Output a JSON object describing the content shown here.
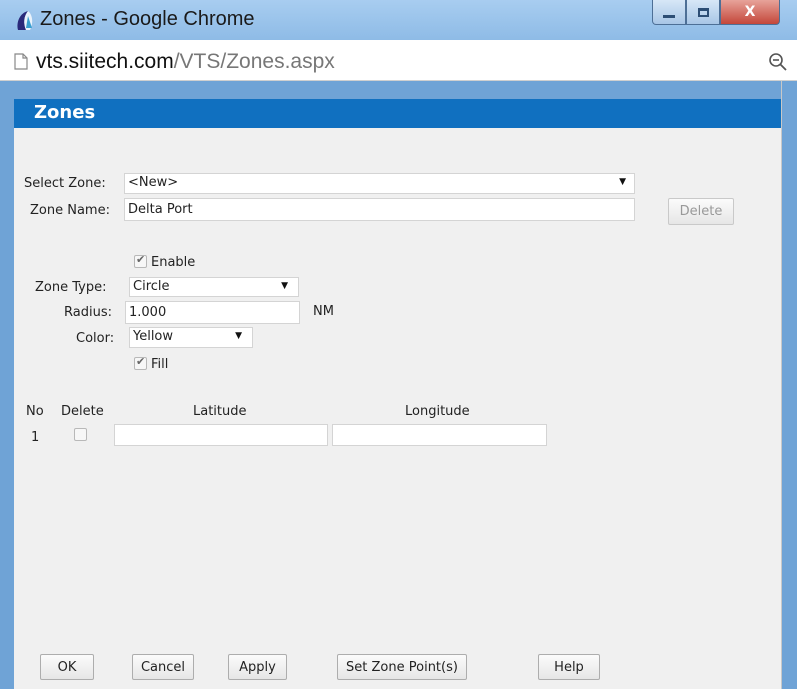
{
  "window": {
    "title": "Zones - Google Chrome",
    "controls": {
      "minimize": "minimize",
      "maximize": "maximize",
      "close": "X"
    }
  },
  "address": {
    "domain": "vts.siitech.com",
    "path": "/VTS/Zones.aspx"
  },
  "header": {
    "title": "Zones"
  },
  "form": {
    "select_zone_label": "Select Zone:",
    "select_zone_value": "<New>",
    "zone_name_label": "Zone Name:",
    "zone_name_value": "Delta Port",
    "delete_button": "Delete",
    "enable_label": "Enable",
    "enable_checked": true,
    "zone_type_label": "Zone Type:",
    "zone_type_value": "Circle",
    "radius_label": "Radius:",
    "radius_value": "1.000",
    "radius_unit": "NM",
    "color_label": "Color:",
    "color_value": "Yellow",
    "fill_label": "Fill",
    "fill_checked": true
  },
  "points_table": {
    "columns": [
      "No",
      "Delete",
      "Latitude",
      "Longitude"
    ],
    "rows": [
      {
        "no": "1",
        "delete": false,
        "latitude": "",
        "longitude": ""
      }
    ]
  },
  "footer_buttons": {
    "ok": "OK",
    "cancel": "Cancel",
    "apply": "Apply",
    "set_zone_points": "Set Zone Point(s)",
    "help": "Help"
  },
  "colors": {
    "header_bg": "#1070c0",
    "frame": "#6fa3d6",
    "close_button": "#c4473a"
  }
}
